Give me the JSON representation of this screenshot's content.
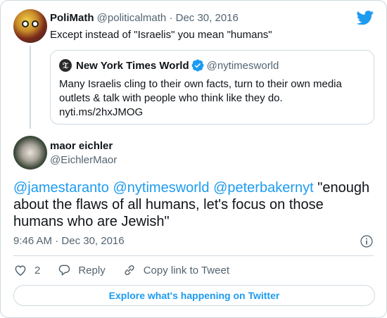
{
  "colors": {
    "accent": "#1d9bf0",
    "muted": "#536471",
    "border": "#cfd9de",
    "verified": "#1d9bf0"
  },
  "parent_tweet": {
    "name": "PoliMath",
    "handle": "@politicalmath",
    "separator": "·",
    "date": "Dec 30, 2016",
    "text": "Except instead of \"Israelis\" you mean \"humans\""
  },
  "quoted_tweet": {
    "name": "New York Times World",
    "handle": "@nytimesworld",
    "text": "Many Israelis cling to their own facts, turn to their own media outlets & talk with people who think like they do.",
    "link": "nyti.ms/2hxJMOG"
  },
  "main_tweet": {
    "name": "maor eichler",
    "handle": "@EichlerMaor",
    "mention_1": "@jamestaranto",
    "mention_2": "@nytimesworld",
    "mention_3": "@peterbakernyt",
    "text": " \"enough about the flaws of all humans, let's focus on those humans who are Jewish\"",
    "time": "9:46 AM",
    "separator": "·",
    "date": "Dec 30, 2016"
  },
  "actions": {
    "like_count": "2",
    "reply_label": "Reply",
    "copy_link_label": "Copy link to Tweet"
  },
  "footer": {
    "explore_label": "Explore what's happening on Twitter"
  },
  "icons": [
    "twitter-bird-icon",
    "verified-badge-icon",
    "info-icon",
    "heart-icon",
    "reply-icon",
    "link-icon"
  ]
}
